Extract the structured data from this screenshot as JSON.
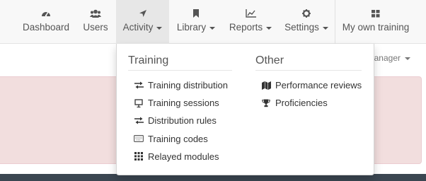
{
  "nav": {
    "items": [
      {
        "label": "Dashboard",
        "icon": "dashboard-icon"
      },
      {
        "label": "Users",
        "icon": "users-icon"
      },
      {
        "label": "Activity",
        "icon": "paper-plane-icon"
      },
      {
        "label": "Library",
        "icon": "bookmark-icon"
      },
      {
        "label": "Reports",
        "icon": "line-chart-icon"
      },
      {
        "label": "Settings",
        "icon": "gear-icon"
      },
      {
        "label": "My own training",
        "icon": "grid-icon"
      }
    ],
    "active": "Activity"
  },
  "subbar": {
    "manager_label": "Manager"
  },
  "dropdown": {
    "training": {
      "heading": "Training",
      "items": [
        {
          "label": "Training distribution",
          "icon": "exchange-icon"
        },
        {
          "label": "Training sessions",
          "icon": "presentation-icon"
        },
        {
          "label": "Distribution rules",
          "icon": "exchange-icon"
        },
        {
          "label": "Training codes",
          "icon": "keyboard-icon"
        },
        {
          "label": "Relayed modules",
          "icon": "th-icon"
        }
      ]
    },
    "other": {
      "heading": "Other",
      "items": [
        {
          "label": "Performance reviews",
          "icon": "map-icon"
        },
        {
          "label": "Proficiencies",
          "icon": "trophy-icon"
        }
      ]
    }
  },
  "colors": {
    "nav_bg": "#f8f8f8",
    "nav_active_bg": "#e7e7e7",
    "alert_bg": "#f2dede",
    "footer_bg": "#3b4651"
  }
}
